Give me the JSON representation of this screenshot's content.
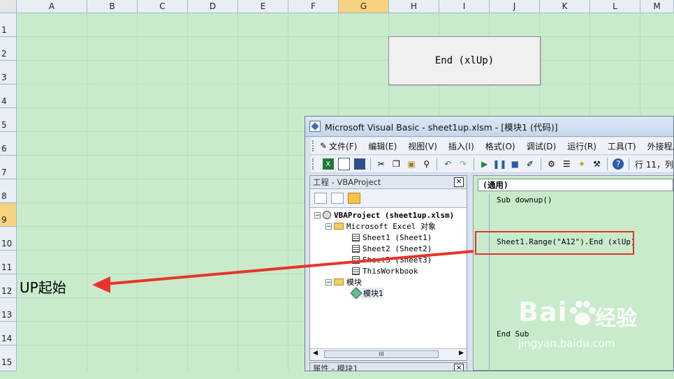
{
  "spreadsheet": {
    "columns": [
      "A",
      "B",
      "C",
      "D",
      "E",
      "F",
      "G",
      "H",
      "I",
      "J",
      "K",
      "L",
      "M"
    ],
    "selected_column": "G",
    "rows": [
      "1",
      "2",
      "3",
      "4",
      "5",
      "6",
      "7",
      "8",
      "9",
      "10",
      "11",
      "12",
      "13",
      "14",
      "15"
    ],
    "selected_row": "9",
    "form_button_label": "End (xlUp)",
    "cell_label": "UP起始",
    "background_color": "#c9ebcc",
    "highlight_color": "#f8d37f"
  },
  "vbe": {
    "title": "Microsoft Visual Basic - sheet1up.xlsm - [模块1 (代码)]",
    "menu": [
      "文件(F)",
      "编辑(E)",
      "视图(V)",
      "插入(I)",
      "格式(O)",
      "调试(D)",
      "运行(R)",
      "工具(T)",
      "外接程序"
    ],
    "position_text": "行 11，列",
    "toolbar_icons": [
      "excel-icon",
      "insert-userform-icon",
      "save-icon",
      "cut-icon",
      "copy-icon",
      "paste-icon",
      "find-icon",
      "undo-icon",
      "redo-icon",
      "run-icon",
      "break-icon",
      "reset-icon",
      "design-mode-icon",
      "project-explorer-icon",
      "properties-icon",
      "object-browser-icon",
      "toolbox-icon",
      "help-icon"
    ],
    "project_pane": {
      "title": "工程 - VBAProject",
      "close": "×",
      "tree": {
        "project": "VBAProject (sheet1up.xlsm)",
        "excel_objects": "Microsoft Excel 对象",
        "sheets": [
          "Sheet1 (Sheet1)",
          "Sheet2 (Sheet2)",
          "Sheet3 (Sheet3)"
        ],
        "workbook": "ThisWorkbook",
        "modules_folder": "模块",
        "module": "模块1"
      },
      "scroll_thumb": "III"
    },
    "properties_pane": {
      "title": "属性 - 模块1",
      "close": "×"
    },
    "code_pane": {
      "combo": "(通用)",
      "lines": {
        "sub_start": "Sub downup()",
        "statement": "Sheet1.Range(\"A12\").End (xlUp)",
        "sub_end": "End Sub"
      }
    }
  },
  "annotation": {
    "box_color": "#e0352b",
    "arrow_color": "#e8342b"
  },
  "watermark": {
    "brand": "Bai",
    "brand_cn": "经验",
    "url": "jingyan.baidu.com"
  }
}
